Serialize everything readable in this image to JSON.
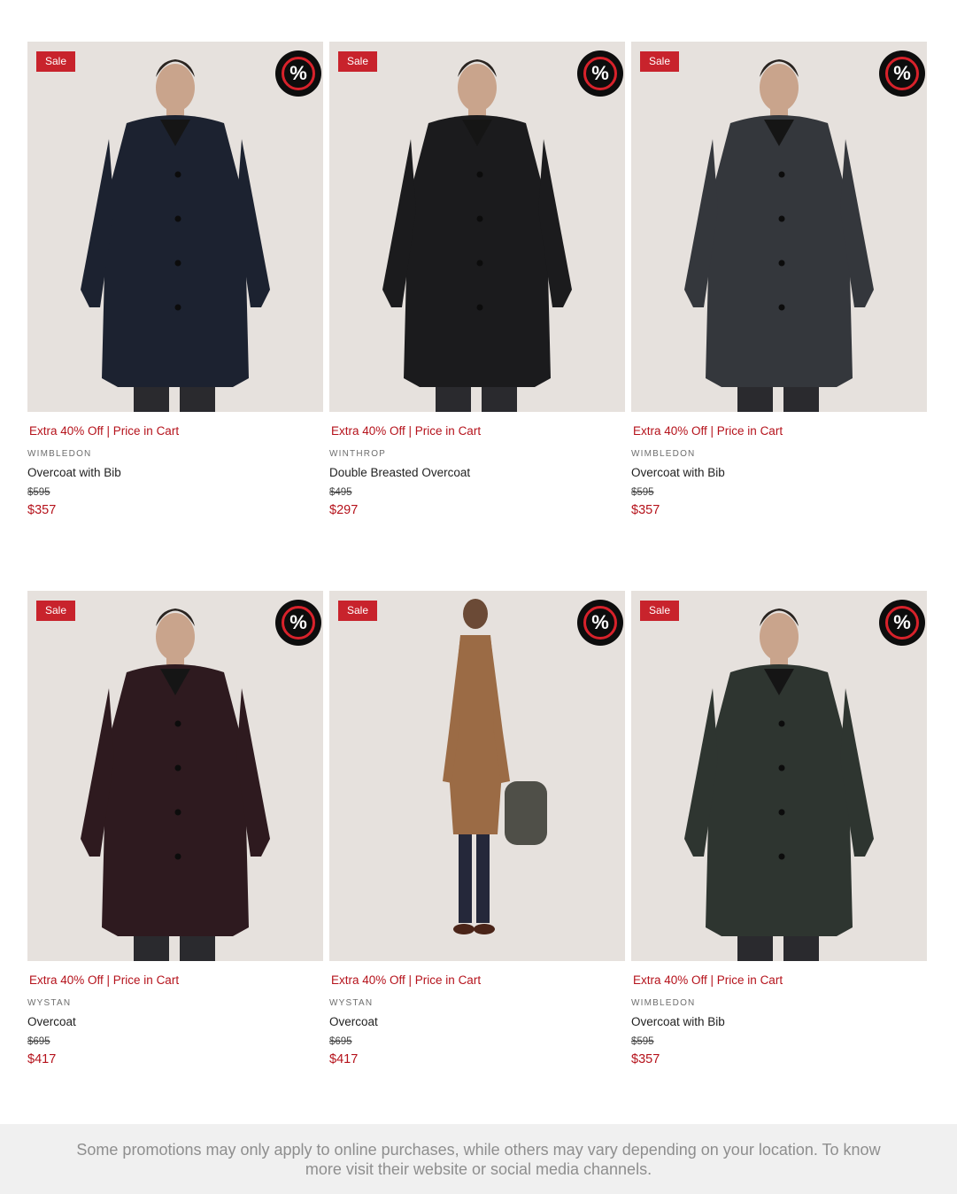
{
  "colors": {
    "accent": "#b5121b",
    "badge_bg": "#c8232c",
    "image_bg": "#e6e1dd",
    "footer_bg": "#f0f0f0"
  },
  "products": [
    {
      "badge": "Sale",
      "promo_icon": "%",
      "promo": "Extra 40% Off | Price in Cart",
      "brand": "WIMBLEDON",
      "name": "Overcoat with Bib",
      "original_price": "$595",
      "sale_price": "$357",
      "coat_color": "#1c2230",
      "pose": "stand"
    },
    {
      "badge": "Sale",
      "promo_icon": "%",
      "promo": "Extra 40% Off | Price in Cart",
      "brand": "WINTHROP",
      "name": "Double Breasted Overcoat",
      "original_price": "$495",
      "sale_price": "$297",
      "coat_color": "#1b1b1d",
      "pose": "stand"
    },
    {
      "badge": "Sale",
      "promo_icon": "%",
      "promo": "Extra 40% Off | Price in Cart",
      "brand": "WIMBLEDON",
      "name": "Overcoat with Bib",
      "original_price": "$595",
      "sale_price": "$357",
      "coat_color": "#34373c",
      "pose": "stand"
    },
    {
      "badge": "Sale",
      "promo_icon": "%",
      "promo": "Extra 40% Off | Price in Cart",
      "brand": "WYSTAN",
      "name": "Overcoat",
      "original_price": "$695",
      "sale_price": "$417",
      "coat_color": "#2e1a1f",
      "pose": "stand"
    },
    {
      "badge": "Sale",
      "promo_icon": "%",
      "promo": "Extra 40% Off | Price in Cart",
      "brand": "WYSTAN",
      "name": "Overcoat",
      "original_price": "$695",
      "sale_price": "$417",
      "coat_color": "#9b6b45",
      "pose": "full"
    },
    {
      "badge": "Sale",
      "promo_icon": "%",
      "promo": "Extra 40% Off | Price in Cart",
      "brand": "WIMBLEDON",
      "name": "Overcoat with Bib",
      "original_price": "$595",
      "sale_price": "$357",
      "coat_color": "#2e3530",
      "pose": "stand"
    }
  ],
  "footer": {
    "text": "Some promotions may only apply to online purchases, while others may vary depending on your location. To know more visit their website or social media channels."
  }
}
